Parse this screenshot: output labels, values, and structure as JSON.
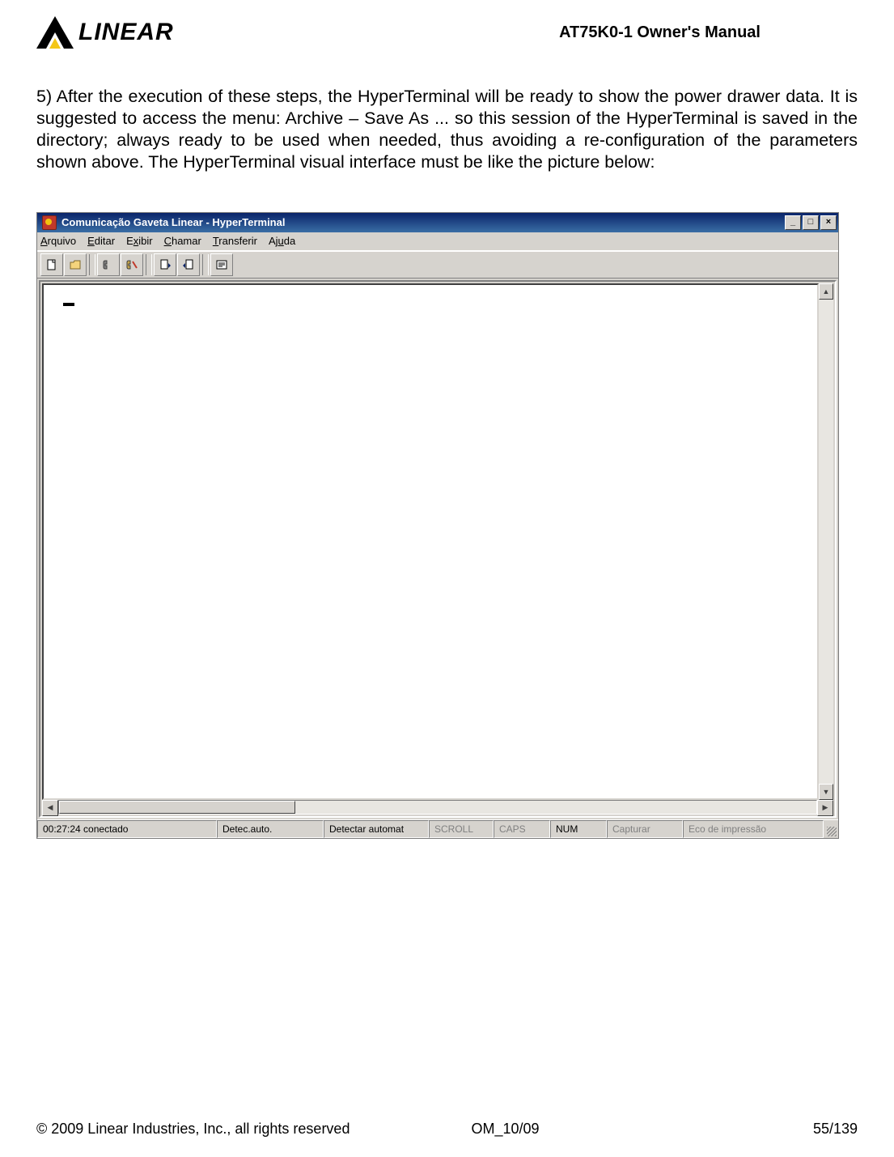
{
  "header": {
    "logo_text": "LINEAR",
    "title": "AT75K0-1 Owner's Manual"
  },
  "body": {
    "paragraph": "5) After the execution of these steps, the HyperTerminal will be ready to show the power drawer data. It is suggested to access the menu: Archive – Save As ...  so this session of the HyperTerminal is saved in the directory; always ready to be used when needed, thus avoiding a re-configuration of the parameters shown above. The HyperTerminal visual interface must be like the picture below:"
  },
  "window": {
    "title": "Comunicação Gaveta Linear - HyperTerminal",
    "btn_min": "_",
    "btn_max": "□",
    "btn_close": "×"
  },
  "menu": {
    "arquivo": "Arquivo",
    "editar": "Editar",
    "exibir": "Exibir",
    "chamar": "Chamar",
    "transferir": "Transferir",
    "ajuda": "Ajuda"
  },
  "status": {
    "time": "00:27:24 conectado",
    "detect": "Detec.auto.",
    "detect_full": "Detectar automat",
    "scroll": "SCROLL",
    "caps": "CAPS",
    "num": "NUM",
    "capture": "Capturar",
    "echo": "Eco de impressão"
  },
  "footer": {
    "left": "© 2009 Linear Industries, Inc., all rights reserved",
    "center": "OM_10/09",
    "right": "55/139"
  }
}
